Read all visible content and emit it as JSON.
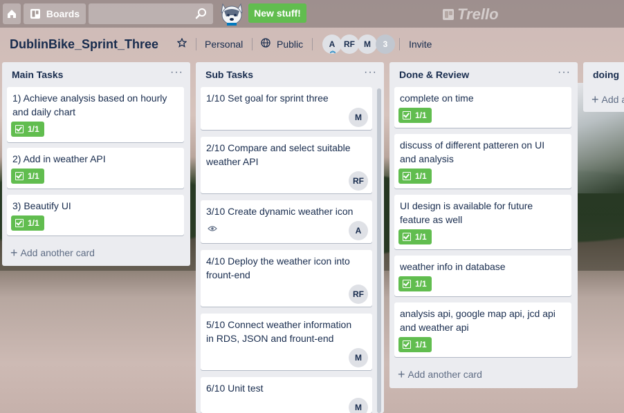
{
  "topbar": {
    "boards_label": "Boards",
    "search_placeholder": "",
    "new_stuff_label": "New stuff!",
    "logo_text": "Trello"
  },
  "board": {
    "title": "DublinBike_Sprint_Three",
    "visibility_team": "Personal",
    "visibility_public": "Public",
    "members": [
      "A",
      "RF",
      "M"
    ],
    "member_count": "3",
    "invite_label": "Invite"
  },
  "lists": [
    {
      "title": "Main Tasks",
      "menu": "···",
      "cards": [
        {
          "text": "1) Achieve analysis based on hourly and daily chart",
          "badge": "1/1"
        },
        {
          "text": "2) Add in weather API",
          "badge": "1/1"
        },
        {
          "text": "3) Beautify UI",
          "badge": "1/1"
        }
      ],
      "add_label": "Add another card"
    },
    {
      "title": "Sub Tasks",
      "menu": "···",
      "cards": [
        {
          "text": "1/10 Set goal for sprint three",
          "member": "M"
        },
        {
          "text": "2/10 Compare and select suitable weather API",
          "member": "RF"
        },
        {
          "text": "3/10 Create dynamic weather icon",
          "member": "A"
        },
        {
          "text": "4/10 Deploy the weather icon into frount-end",
          "member": "RF"
        },
        {
          "text": "5/10 Connect weather information in RDS, JSON and frount-end",
          "member": "M"
        },
        {
          "text": "6/10 Unit test",
          "member": "M"
        }
      ]
    },
    {
      "title": "Done & Review",
      "menu": "···",
      "cards": [
        {
          "text": "complete on time",
          "badge": "1/1"
        },
        {
          "text": "discuss of different patteren on UI and analysis",
          "badge": "1/1"
        },
        {
          "text": "UI design is available for future feature as well",
          "badge": "1/1"
        },
        {
          "text": "weather info in database",
          "badge": "1/1"
        },
        {
          "text": "analysis api, google map api, jcd api and weather api",
          "badge": "1/1"
        }
      ],
      "add_label": "Add another card"
    },
    {
      "title": "doing",
      "add_label": "Add a"
    }
  ]
}
